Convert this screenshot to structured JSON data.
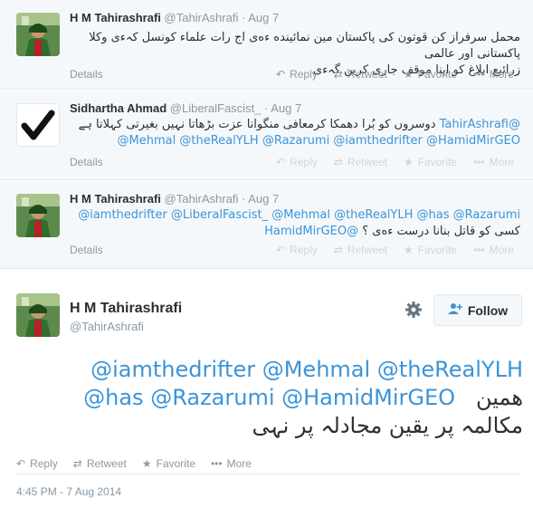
{
  "tweets": [
    {
      "fullname": "H M Tahirashrafi",
      "screenname": "@TahirAshrafi",
      "dot": "·",
      "time": "Aug 7",
      "lines": [
        "محمل سرفراز کن قوتون کی پاکستان مین نمائینده ءه‌ی اج رات علماء کونسل کہ‌ءی وکلا پاکستانی اور عالمی",
        "زرائیع ابلاغ کو اپنا موقف جاری کرین گہ‌ءی"
      ],
      "details": "Details",
      "actions": [
        "Reply",
        "Retweet",
        "Favorite",
        "More"
      ]
    },
    {
      "fullname": "Sidhartha Ahmad",
      "screenname": "@LiberalFascist_",
      "dot": "·",
      "time": "Aug 7",
      "line1_mention": "@TahirAshrafi",
      "line1_text": "دوسروں کو بُرا دھمکا کرمعافی منگوانا عزت بڑھاتا نہیں بغیرتی کہلاتا ہے",
      "line2": "@Mehmal @theRealYLH @Razarumi @iamthedrifter @HamidMirGEO",
      "details": "Details",
      "actions": [
        "Reply",
        "Retweet",
        "Favorite",
        "More"
      ]
    },
    {
      "fullname": "H M Tahirashrafi",
      "screenname": "@TahirAshrafi",
      "dot": "·",
      "time": "Aug 7",
      "line1": "@iamthedrifter @LiberalFascist_ @Mehmal @theRealYLH @has @Razarumi",
      "line2_mention": "@HamidMirGEO",
      "line2_text": "کسی کو قاتل بنانا درست ءه‌ی ؟",
      "details": "Details",
      "actions": [
        "Reply",
        "Retweet",
        "Favorite",
        "More"
      ]
    }
  ],
  "main": {
    "fullname": "H M Tahirashrafi",
    "screenname": "@TahirAshrafi",
    "follow_label": "Follow",
    "line1": "@iamthedrifter @Mehmal @theRealYLH",
    "line2_mentions": "@has @Razarumi @HamidMirGEO",
    "line2_text": "همین",
    "line3": "مکالمہ پر یقین مجادلہ پر نہی",
    "actions": [
      "Reply",
      "Retweet",
      "Favorite",
      "More"
    ],
    "timestamp": "4:45 PM - 7 Aug 2014"
  },
  "colors": {
    "link": "#3b94d9",
    "muted": "#8899a6",
    "faded": "#ccd6dd"
  }
}
